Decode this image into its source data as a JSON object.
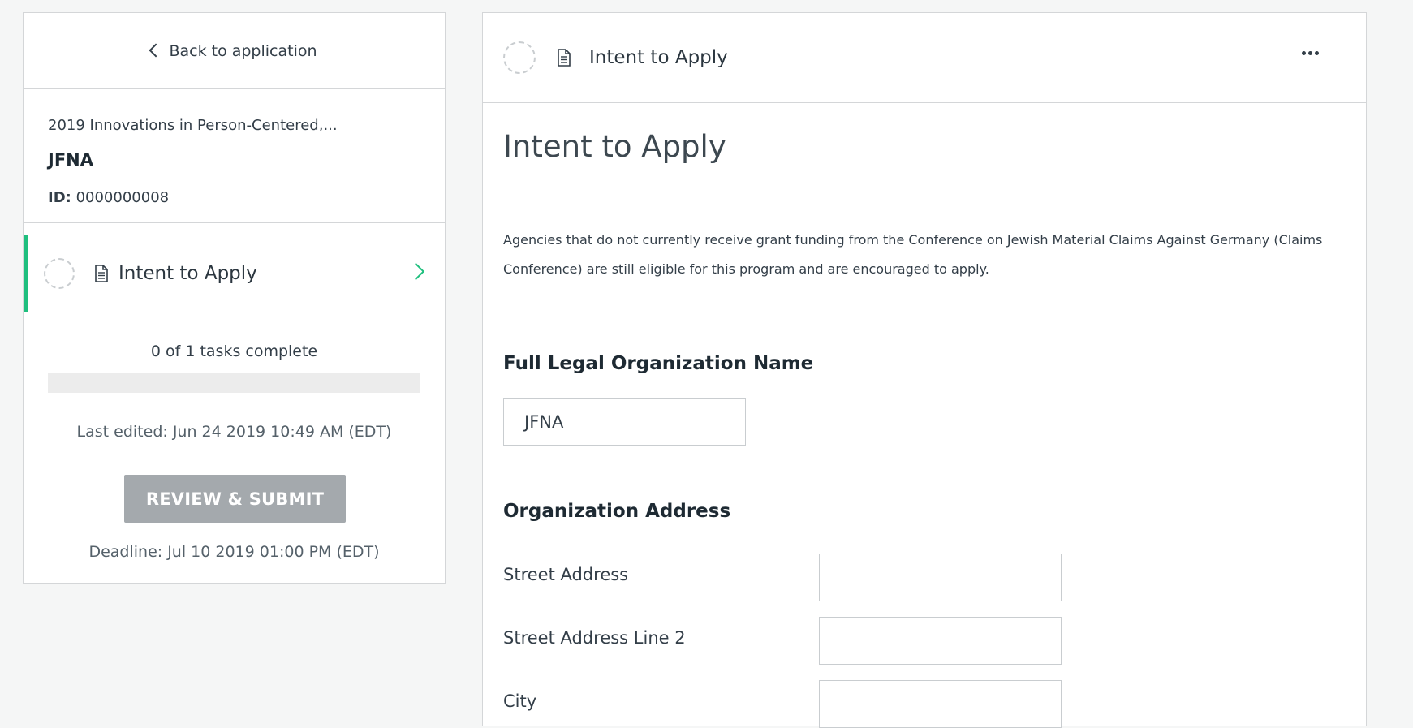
{
  "sidebar": {
    "back_label": "Back to application",
    "application_name": "2019 Innovations in Person-Centered,...",
    "organization": "JFNA",
    "id_label": "ID:",
    "id_value": "0000000008",
    "task": {
      "label": "Intent to Apply",
      "status": "incomplete"
    },
    "progress_text": "0 of 1 tasks complete",
    "progress_fraction": 0,
    "last_edited": "Last edited: Jun 24 2019 10:49 AM (EDT)",
    "submit_label": "REVIEW & SUBMIT",
    "deadline": "Deadline: Jul 10 2019 01:00 PM (EDT)"
  },
  "main": {
    "header_title": "Intent to Apply",
    "page_title": "Intent to Apply",
    "intro_text": "Agencies that do not currently receive grant funding from the Conference on Jewish Material Claims Against Germany (Claims Conference) are still eligible for this program and are encouraged to apply.",
    "org_name_heading": "Full Legal Organization Name",
    "org_name_value": "JFNA",
    "address_heading": "Organization Address",
    "fields": [
      {
        "label": "Street Address",
        "value": ""
      },
      {
        "label": "Street Address Line 2",
        "value": ""
      },
      {
        "label": "City",
        "value": ""
      }
    ]
  },
  "colors": {
    "accent": "#1fbf7e",
    "disabled_button": "#a4a9ad",
    "border": "#d4d6d8",
    "background": "#f5f6f6"
  },
  "icons": [
    "chevron-left-icon",
    "status-circle-icon",
    "document-icon",
    "chevron-right-icon",
    "more-options-icon"
  ]
}
